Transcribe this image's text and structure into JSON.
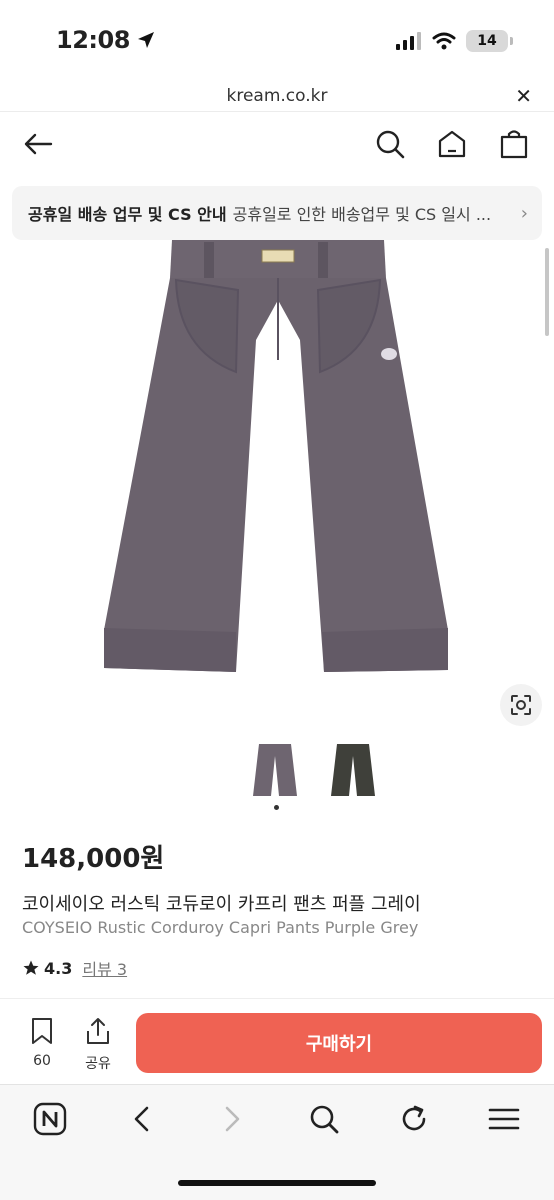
{
  "status_bar": {
    "time": "12:08",
    "battery": "14"
  },
  "browser": {
    "url": "kream.co.kr"
  },
  "notice": {
    "title": "공휴일 배송 업무 및 CS 안내",
    "text": "공휴일로 인한 배송업무 및 CS 일시 ..."
  },
  "product": {
    "price": "148,000원",
    "name_ko": "코이세이오 러스틱 코듀로이 카프리 팬츠 퍼플 그레이",
    "name_en": "COYSEIO Rustic Corduroy Capri Pants Purple Grey",
    "rating": "4.3",
    "review_label": "리뷰 3",
    "label_tag": "COYSEIO",
    "image_color": "#6e6570",
    "thumb_colors": [
      "#6e6570",
      "#3f403a"
    ]
  },
  "actions": {
    "wishlist_count": "60",
    "share_label": "공유",
    "buy_label": "구매하기",
    "buy_color": "#ef6253"
  }
}
